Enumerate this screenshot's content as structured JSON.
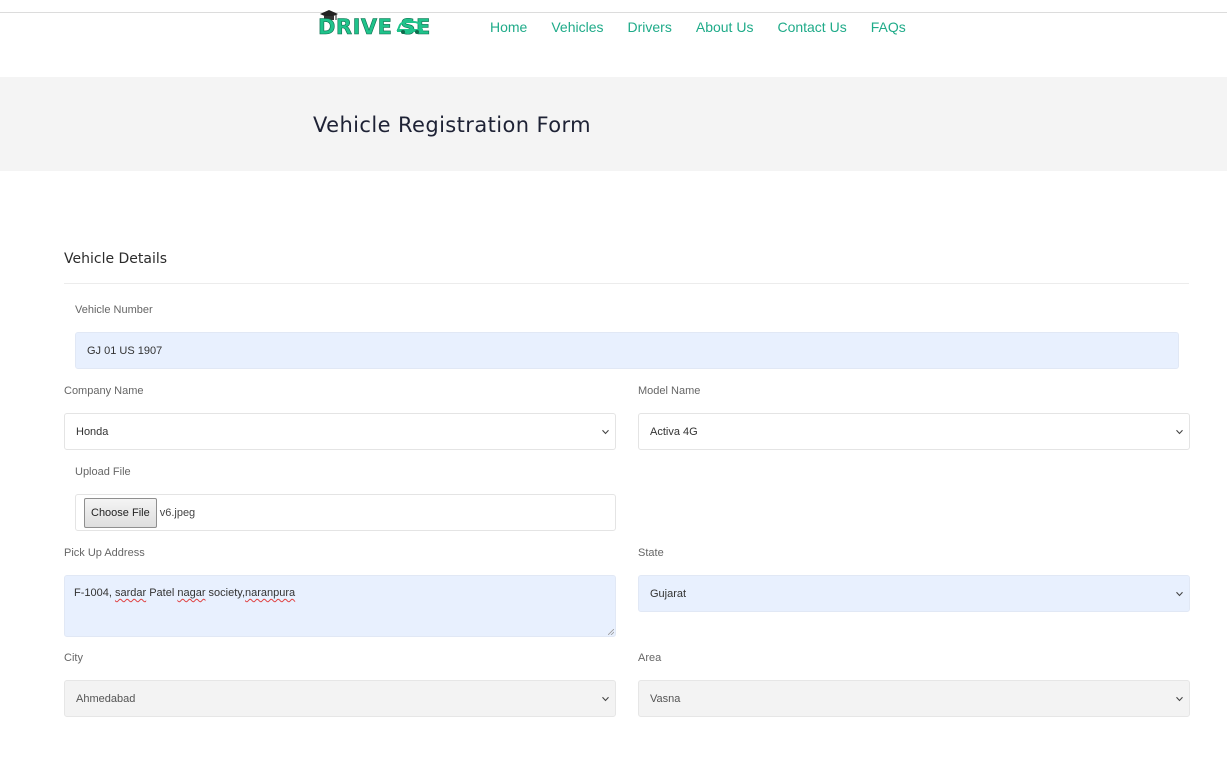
{
  "brand": {
    "logo_text": "DRIVE   SE",
    "logo_alt": "DRIVEASE"
  },
  "nav": {
    "items": [
      {
        "label": "Home",
        "name": "nav-home"
      },
      {
        "label": "Vehicles",
        "name": "nav-vehicles"
      },
      {
        "label": "Drivers",
        "name": "nav-drivers"
      },
      {
        "label": "About Us",
        "name": "nav-about-us"
      },
      {
        "label": "Contact Us",
        "name": "nav-contact-us"
      },
      {
        "label": "FAQs",
        "name": "nav-faqs"
      }
    ]
  },
  "banner": {
    "title": "Vehicle Registration Form"
  },
  "form": {
    "section_title": "Vehicle Details",
    "vehicle_number": {
      "label": "Vehicle Number",
      "value": "GJ 01 US 1907"
    },
    "company_name": {
      "label": "Company Name",
      "value": "Honda"
    },
    "model_name": {
      "label": "Model Name",
      "value": "Activa 4G"
    },
    "upload_file": {
      "label": "Upload File",
      "button": "Choose File",
      "file": "v6.jpeg"
    },
    "pickup_address": {
      "label": "Pick Up Address",
      "value_parts": [
        "F-1004, ",
        "sardar",
        " Patel ",
        "nagar",
        " society,",
        "naranpura"
      ]
    },
    "state": {
      "label": "State",
      "value": "Gujarat"
    },
    "city": {
      "label": "City",
      "value": "Ahmedabad"
    },
    "area": {
      "label": "Area",
      "value": "Vasna"
    }
  },
  "colors": {
    "accent": "#1fab89",
    "banner_bg": "#f4f4f4",
    "autofill_bg": "#e8f0fe"
  }
}
